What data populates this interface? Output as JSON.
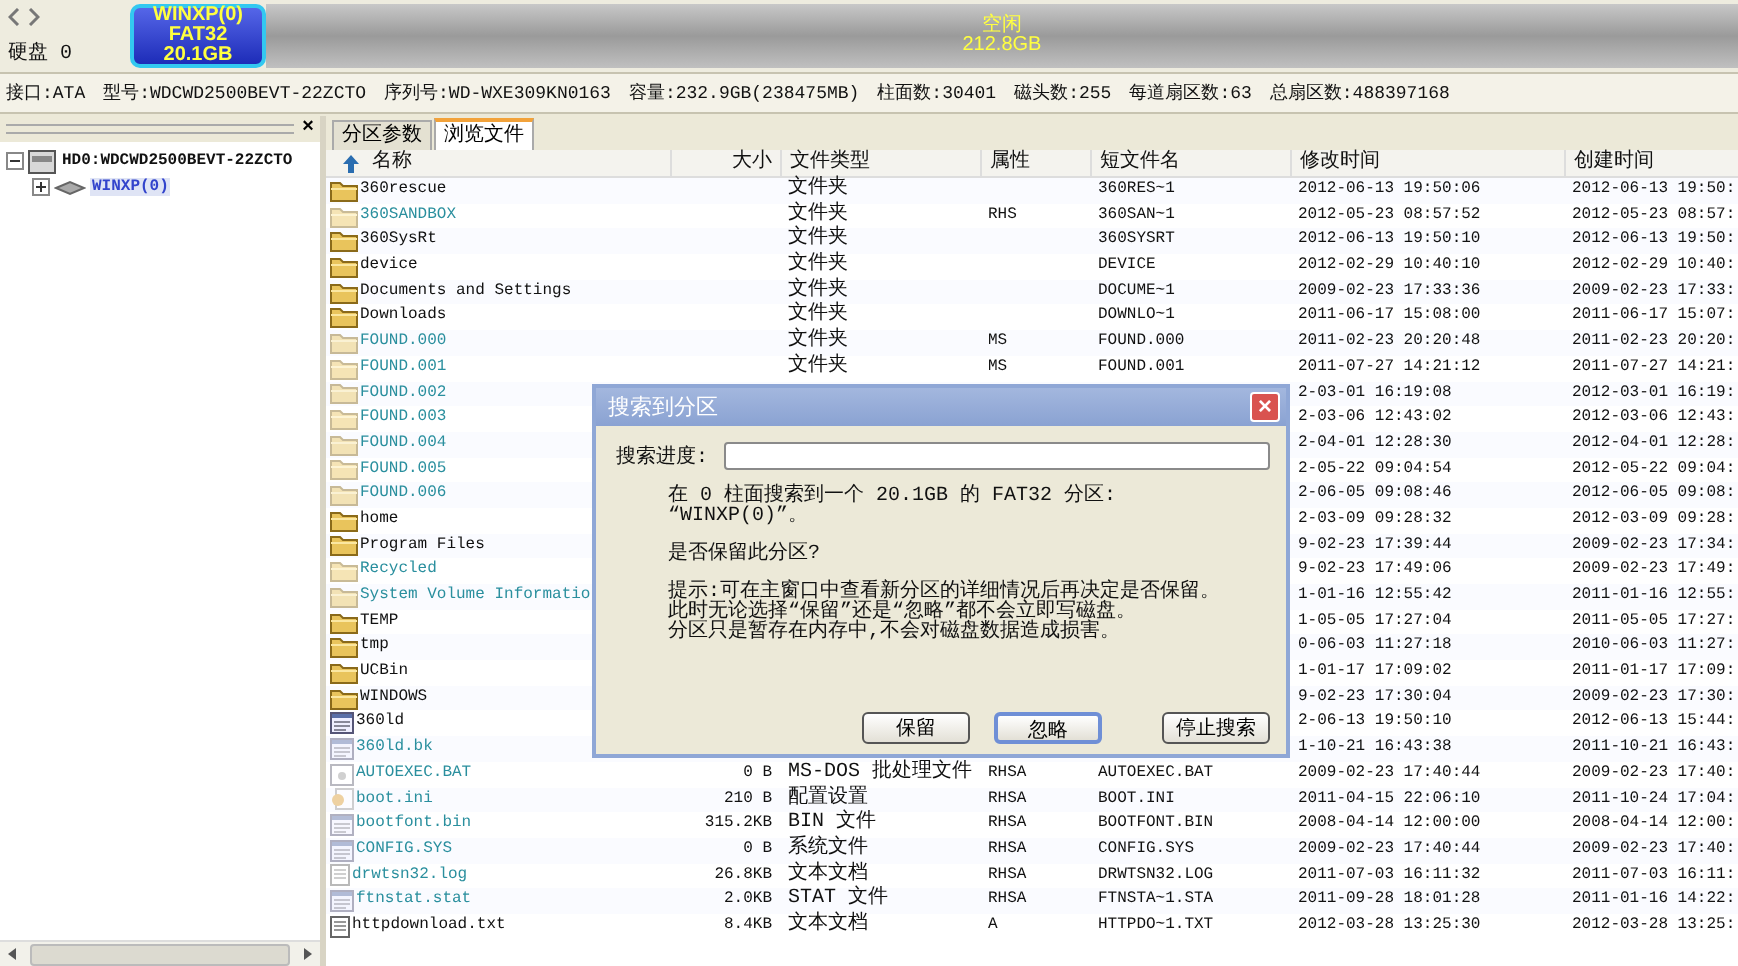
{
  "disk_bar": {
    "disk_label": "硬盘 0",
    "partitions": [
      {
        "kind": "used",
        "lines": [
          "WINXP(0)",
          "FAT32",
          "20.1GB"
        ]
      },
      {
        "kind": "free",
        "lines": [
          "空闲",
          "212.8GB"
        ]
      }
    ]
  },
  "disk_info": [
    "接口:ATA",
    "型号:WDCWD2500BEVT-22ZCTO",
    "序列号:WD-WXE309KN0163",
    "容量:232.9GB(238475MB)",
    "柱面数:30401",
    "磁头数:255",
    "每道扇区数:63",
    "总扇区数:488397168"
  ],
  "tree_panel": {
    "close": "×",
    "items": [
      {
        "label": "HD0:WDCWD2500BEVT-22ZCTO",
        "kind": "disk",
        "expanded": true,
        "selected": false,
        "children": [
          {
            "label": "WINXP(0)",
            "kind": "partition",
            "expanded": false,
            "selected": true
          }
        ]
      }
    ]
  },
  "tabs": [
    {
      "label": "分区参数",
      "selected": false
    },
    {
      "label": "浏览文件",
      "selected": true
    }
  ],
  "files": {
    "columns": [
      "名称",
      "大小",
      "文件类型",
      "属性",
      "短文件名",
      "修改时间",
      "创建时间"
    ],
    "rows": [
      {
        "name": "360rescue",
        "kind": "folder",
        "hidden": false,
        "type": "文件夹",
        "short": "360RES~1",
        "modified": "2012-06-13 19:50:06",
        "created": "2012-06-13 19:50:"
      },
      {
        "name": "360SANDBOX",
        "kind": "folder",
        "hidden": true,
        "type": "文件夹",
        "attr": "RHS",
        "short": "360SAN~1",
        "modified": "2012-05-23 08:57:52",
        "created": "2012-05-23 08:57:"
      },
      {
        "name": "360SysRt",
        "kind": "folder",
        "hidden": false,
        "type": "文件夹",
        "short": "360SYSRT",
        "modified": "2012-06-13 19:50:10",
        "created": "2012-06-13 19:50:"
      },
      {
        "name": "device",
        "kind": "folder",
        "hidden": false,
        "type": "文件夹",
        "short": "DEVICE",
        "modified": "2012-02-29 10:40:10",
        "created": "2012-02-29 10:40:"
      },
      {
        "name": "Documents and Settings",
        "kind": "folder",
        "hidden": false,
        "type": "文件夹",
        "short": "DOCUME~1",
        "modified": "2009-02-23 17:33:36",
        "created": "2009-02-23 17:33:"
      },
      {
        "name": "Downloads",
        "kind": "folder",
        "hidden": false,
        "type": "文件夹",
        "short": "DOWNLO~1",
        "modified": "2011-06-17 15:08:00",
        "created": "2011-06-17 15:07:"
      },
      {
        "name": "FOUND.000",
        "kind": "folder",
        "hidden": true,
        "type": "文件夹",
        "attr": "MS",
        "short": "FOUND.000",
        "modified": "2011-02-23 20:20:48",
        "created": "2011-02-23 20:20:"
      },
      {
        "name": "FOUND.001",
        "kind": "folder",
        "hidden": true,
        "type": "文件夹",
        "attr": "MS",
        "short": "FOUND.001",
        "modified": "2011-07-27 14:21:12",
        "created": "2011-07-27 14:21:"
      },
      {
        "name": "FOUND.002",
        "kind": "folder",
        "hidden": true,
        "modified": "2-03-01 16:19:08",
        "created": "2012-03-01 16:19:"
      },
      {
        "name": "FOUND.003",
        "kind": "folder",
        "hidden": true,
        "modified": "2-03-06 12:43:02",
        "created": "2012-03-06 12:43:"
      },
      {
        "name": "FOUND.004",
        "kind": "folder",
        "hidden": true,
        "modified": "2-04-01 12:28:30",
        "created": "2012-04-01 12:28:"
      },
      {
        "name": "FOUND.005",
        "kind": "folder",
        "hidden": true,
        "modified": "2-05-22 09:04:54",
        "created": "2012-05-22 09:04:"
      },
      {
        "name": "FOUND.006",
        "kind": "folder",
        "hidden": true,
        "modified": "2-06-05 09:08:46",
        "created": "2012-06-05 09:08:"
      },
      {
        "name": "home",
        "kind": "folder",
        "hidden": false,
        "modified": "2-03-09 09:28:32",
        "created": "2012-03-09 09:28:"
      },
      {
        "name": "Program Files",
        "kind": "folder",
        "hidden": false,
        "modified": "9-02-23 17:39:44",
        "created": "2009-02-23 17:34:"
      },
      {
        "name": "Recycled",
        "kind": "folder",
        "hidden": true,
        "modified": "9-02-23 17:49:06",
        "created": "2009-02-23 17:49:"
      },
      {
        "name": "System Volume Informatio",
        "kind": "folder",
        "hidden": true,
        "modified": "1-01-16 12:55:42",
        "created": "2011-01-16 12:55:"
      },
      {
        "name": "TEMP",
        "kind": "folder",
        "hidden": false,
        "modified": "1-05-05 17:27:04",
        "created": "2011-05-05 17:27:"
      },
      {
        "name": "tmp",
        "kind": "folder",
        "hidden": false,
        "modified": "0-06-03 11:27:18",
        "created": "2010-06-03 11:27:"
      },
      {
        "name": "UCBin",
        "kind": "folder",
        "hidden": false,
        "modified": "1-01-17 17:09:02",
        "created": "2011-01-17 17:09:"
      },
      {
        "name": "WINDOWS",
        "kind": "folder",
        "hidden": false,
        "modified": "9-02-23 17:30:04",
        "created": "2009-02-23 17:30:"
      },
      {
        "name": "360ld",
        "kind": "file",
        "hidden": false,
        "modified": "2-06-13 19:50:10",
        "created": "2012-06-13 15:44:"
      },
      {
        "name": "360ld.bk",
        "kind": "file",
        "hidden": true,
        "modified": "1-10-21 16:43:38",
        "created": "2011-10-21 16:43:"
      },
      {
        "name": "AUTOEXEC.BAT",
        "kind": "batch",
        "hidden": true,
        "size": "0 B",
        "type": "MS-DOS 批处理文件",
        "attr": "RHSA",
        "short": "AUTOEXEC.BAT",
        "modified": "2009-02-23 17:40:44",
        "created": "2009-02-23 17:40:"
      },
      {
        "name": "boot.ini",
        "kind": "settings",
        "hidden": true,
        "size": "210 B",
        "type": "配置设置",
        "attr": "RHSA",
        "short": "BOOT.INI",
        "modified": "2011-04-15 22:06:10",
        "created": "2011-10-24 17:04:"
      },
      {
        "name": "bootfont.bin",
        "kind": "file",
        "hidden": true,
        "size": "315.2KB",
        "type": "BIN 文件",
        "attr": "RHSA",
        "short": "BOOTFONT.BIN",
        "modified": "2008-04-14 12:00:00",
        "created": "2008-04-14 12:00:"
      },
      {
        "name": "CONFIG.SYS",
        "kind": "file",
        "hidden": true,
        "size": "0 B",
        "type": "系统文件",
        "attr": "RHSA",
        "short": "CONFIG.SYS",
        "modified": "2009-02-23 17:40:44",
        "created": "2009-02-23 17:40:"
      },
      {
        "name": "drwtsn32.log",
        "kind": "text",
        "hidden": true,
        "size": "26.8KB",
        "type": "文本文档",
        "attr": "RHSA",
        "short": "DRWTSN32.LOG",
        "modified": "2011-07-03 16:11:32",
        "created": "2011-07-03 16:11:"
      },
      {
        "name": "ftnstat.stat",
        "kind": "file",
        "hidden": true,
        "size": "2.0KB",
        "type": "STAT 文件",
        "attr": "RHSA",
        "short": "FTNSTA~1.STA",
        "modified": "2011-09-28 18:01:28",
        "created": "2011-01-16 14:22:"
      },
      {
        "name": "httpdownload.txt",
        "kind": "text",
        "hidden": false,
        "size": "8.4KB",
        "type": "文本文档",
        "attr": "A",
        "short": "HTTPDO~1.TXT",
        "modified": "2012-03-28 13:25:30",
        "created": "2012-03-28 13:25:"
      }
    ]
  },
  "dialog": {
    "title": "搜索到分区",
    "close": "×",
    "progress_label": "搜索进度:",
    "progress": {
      "level": 0
    },
    "message": [
      "在 0 柱面搜索到一个 20.1GB 的 FAT32 分区:",
      "“WINXP(0)”。"
    ],
    "question": "是否保留此分区?",
    "hint": [
      "提示:可在主窗口中查看新分区的详细情况后再决定是否保留。",
      "此时无论选择“保留”还是“忽略”都不会立即写磁盘。",
      "分区只是暂存在内存中,不会对磁盘数据造成损害。"
    ],
    "buttons": [
      {
        "label": "保留",
        "focused": false
      },
      {
        "label": "忽略",
        "focused": true
      },
      {
        "label": "停止搜索",
        "focused": false
      }
    ]
  }
}
